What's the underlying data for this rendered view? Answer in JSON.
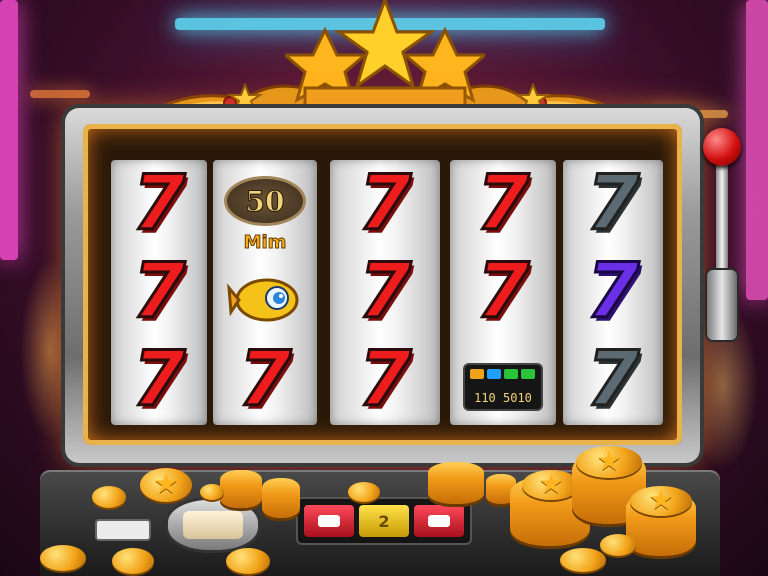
{
  "game": {
    "reels": [
      {
        "symbols": [
          "7",
          "7",
          "7"
        ],
        "colors": [
          "red",
          "red",
          "red"
        ]
      },
      {
        "top_badge": "50",
        "label": "Mim",
        "middle_icon": "fish-icon",
        "bottom": "7",
        "bottom_color": "red"
      },
      {
        "symbols": [
          "7",
          "7",
          "7"
        ],
        "colors": [
          "red",
          "red",
          "red"
        ]
      },
      {
        "symbols": [
          "7",
          "7"
        ],
        "colors": [
          "red",
          "red"
        ],
        "bottom_display": "110 5010",
        "display_lights": [
          "#f0a21a",
          "#1ea0ff",
          "#2ac43a",
          "#2ac43a"
        ]
      },
      {
        "symbols": [
          "7",
          "7",
          "7"
        ],
        "colors": [
          "grey",
          "purple",
          "grey"
        ]
      }
    ],
    "controls": {
      "button_left_icon": "ticket-icon",
      "button_middle_label": "2",
      "button_right_icon": "ticket-icon"
    },
    "colors": {
      "accent_gold": "#f2b01c",
      "seven_red": "#ee1c1c",
      "lever_red": "#d10f0f",
      "neon_cyan": "#5fe3ff",
      "neon_pink": "#ff4fd8"
    }
  }
}
